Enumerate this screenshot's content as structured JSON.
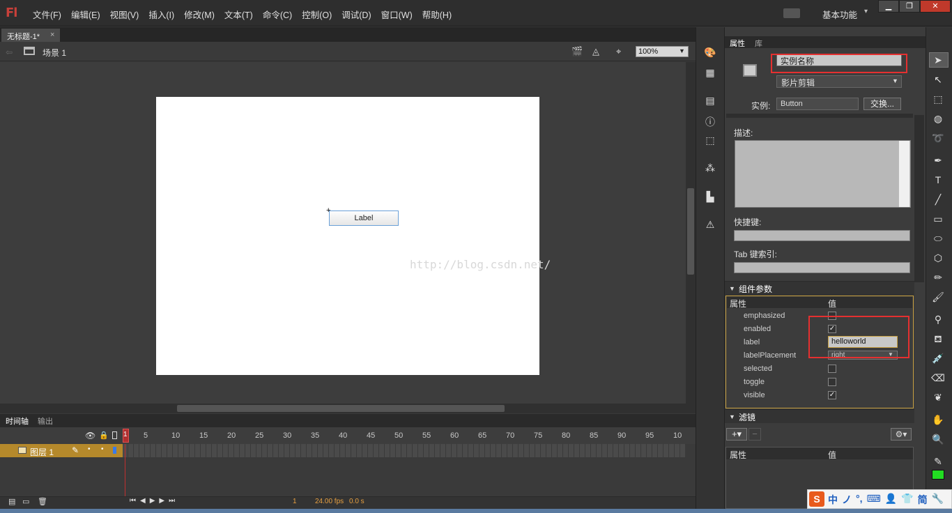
{
  "app": {
    "logo": "Fl",
    "workspace": "基本功能"
  },
  "menu": [
    "文件(F)",
    "编辑(E)",
    "视图(V)",
    "插入(I)",
    "修改(M)",
    "文本(T)",
    "命令(C)",
    "控制(O)",
    "调试(D)",
    "窗口(W)",
    "帮助(H)"
  ],
  "window_buttons": {
    "min": "▁",
    "restore": "❐",
    "close": "✕"
  },
  "document": {
    "tab": "无标题-1*",
    "close": "×"
  },
  "editbar": {
    "scene": "场景 1",
    "zoom": "100%"
  },
  "stage": {
    "button_label": "Label",
    "watermark": "http://blog.csdn.net/"
  },
  "timeline": {
    "tabs": [
      "时间轴",
      "输出"
    ],
    "layer_name": "图层 1",
    "playhead_frame": "1",
    "ruler": [
      "5",
      "10",
      "15",
      "20",
      "25",
      "30",
      "35",
      "40",
      "45",
      "50",
      "55",
      "60",
      "65",
      "70",
      "75",
      "80",
      "85",
      "90",
      "95",
      "10"
    ],
    "bottom": {
      "frame": "1",
      "fps": "24.00 fps",
      "time": "0.0 s"
    }
  },
  "properties": {
    "tabs": [
      "属性",
      "库"
    ],
    "instance_name_placeholder": "实例名称",
    "symbol_type": "影片剪辑",
    "instance_label": "实例:",
    "instance_value": "Button",
    "swap_button": "交换...",
    "description_label": "描述:",
    "shortcut_label": "快捷键:",
    "tab_index_label": "Tab 键索引:"
  },
  "component_params": {
    "title": "组件参数",
    "col_property": "属性",
    "col_value": "值",
    "rows": [
      {
        "name": "emphasized",
        "type": "check",
        "checked": false
      },
      {
        "name": "enabled",
        "type": "check",
        "checked": true
      },
      {
        "name": "label",
        "type": "text",
        "value": "helloworld"
      },
      {
        "name": "labelPlacement",
        "type": "select",
        "value": "right"
      },
      {
        "name": "selected",
        "type": "check",
        "checked": false
      },
      {
        "name": "toggle",
        "type": "check",
        "checked": false
      },
      {
        "name": "visible",
        "type": "check",
        "checked": true
      }
    ]
  },
  "filters": {
    "title": "滤镜",
    "col_property": "属性",
    "col_value": "值",
    "add": "+▾",
    "remove": "−",
    "gear": "⚙▾"
  },
  "ime": {
    "logo": "S",
    "items": [
      "中",
      "ノ",
      "°,",
      "⌨",
      "👤",
      "👕",
      "简",
      "🔧"
    ]
  },
  "colors": {
    "highlight_red": "#e53030",
    "layer_gold": "#b5892b",
    "fill_swatch": "#22dd22"
  }
}
